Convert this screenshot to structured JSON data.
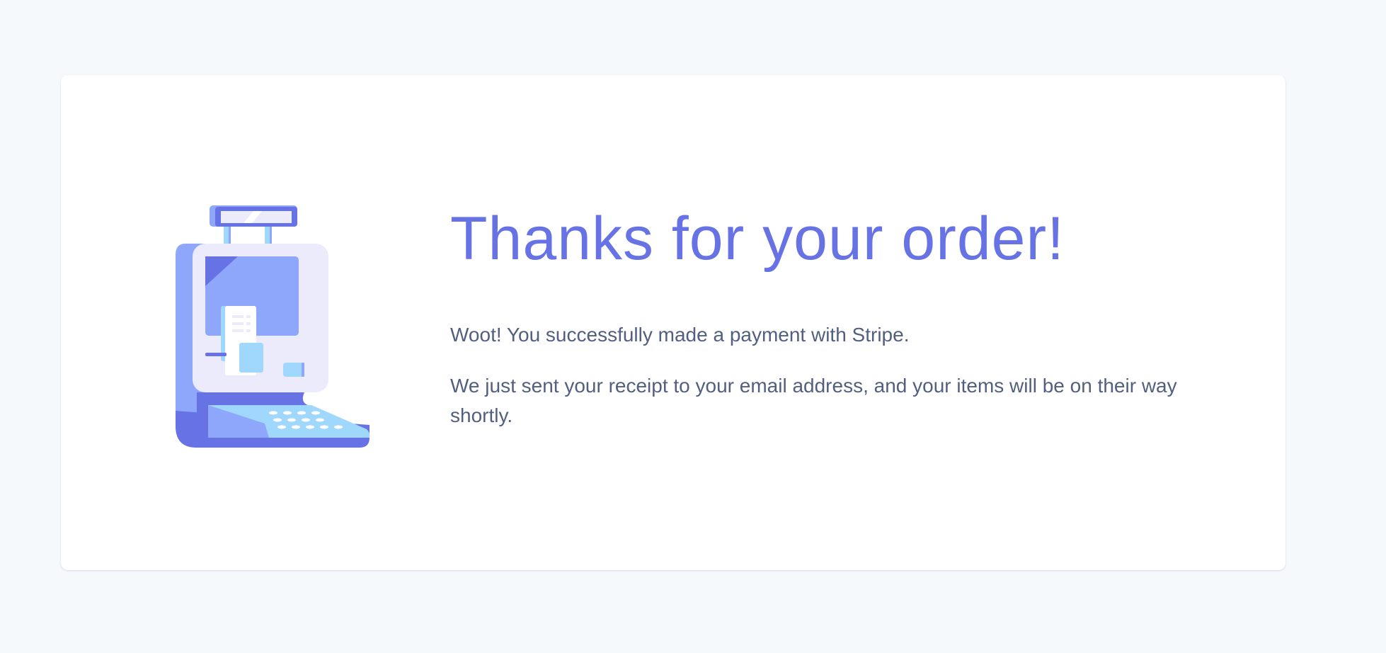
{
  "page": {
    "background": "#f6f9fc"
  },
  "illustration": {
    "name": "payment-terminal-illustration",
    "colors": {
      "indigo": "#6772e5",
      "periwinkle": "#8fa7fb",
      "lavender": "#ecebfb",
      "sky": "#a0d7fd",
      "white": "#ffffff"
    }
  },
  "confirmation": {
    "title": "Thanks for your order!",
    "message_1": "Woot! You successfully made a payment with Stripe.",
    "message_2": "We just sent your receipt to your email address, and your items will be on their way shortly.",
    "title_color": "#6772e5",
    "text_color": "#525f7f"
  }
}
